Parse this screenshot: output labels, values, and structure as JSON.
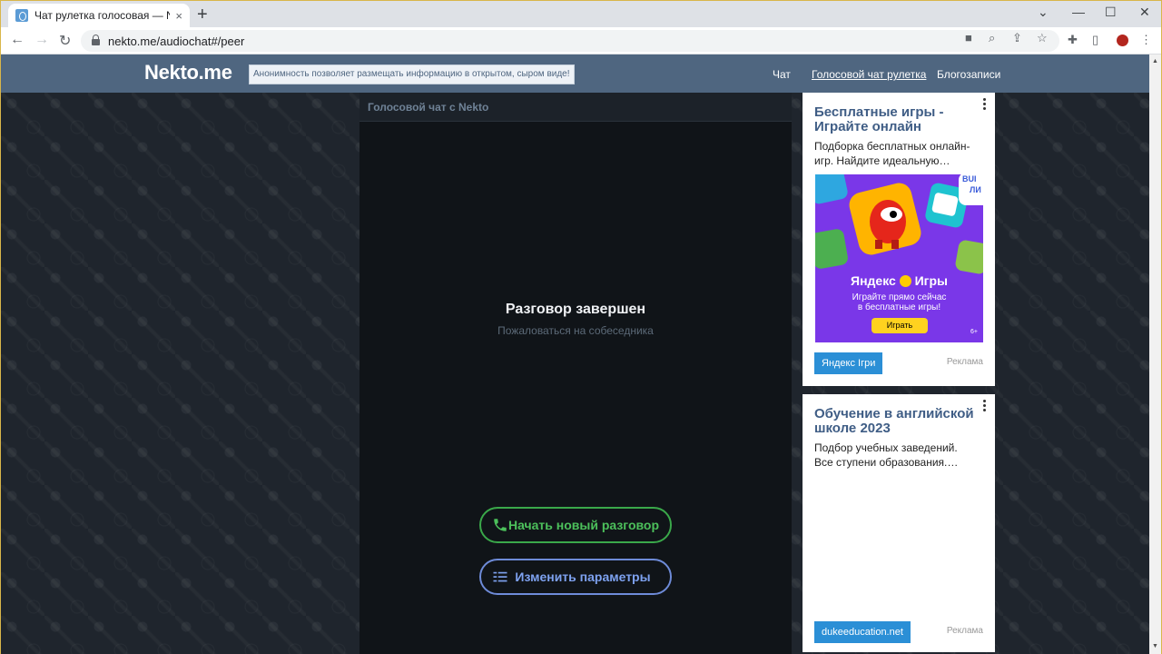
{
  "browser": {
    "tab_title": "Чат рулетка голосовая — Nekto.me",
    "tab_close": "×",
    "new_tab": "+",
    "url": "nekto.me/audiochat#/peer",
    "icons": [
      "camera-icon",
      "zoom-icon",
      "share-icon",
      "star-icon",
      "extensions-icon",
      "sidebar-icon",
      "profile-icon",
      "menu-icon"
    ],
    "window_controls": [
      "⌄",
      "—",
      "☐",
      "✕"
    ]
  },
  "site": {
    "logo": "Nekto.me",
    "tagline": "Анонимность позволяет размещать информацию в открытом, сыром виде!",
    "nav": [
      {
        "label": "Чат"
      },
      {
        "label": "Голосовой чат рулетка"
      },
      {
        "label": "Блогозаписи"
      }
    ],
    "accent_header": "#4f6680"
  },
  "chat": {
    "header_title": "Голосовой чат с Nekto",
    "status_title": "Разговор завершен",
    "report_link": "Пожаловаться на собеседника",
    "new_chat_button": "Начать новый разговор",
    "settings_button": "Изменить параметры",
    "colors": {
      "new_chat": "#4cc05b",
      "settings": "#7ea2f0"
    }
  },
  "ads": [
    {
      "title": "Бесплатные игры - Играйте онлайн",
      "text": "Подборка бесплатных онлайн-игр. Найдите идеальную…",
      "image": {
        "brand": "Яндекс",
        "product": "Игры",
        "tagline_1": "Играйте прямо сейчас",
        "tagline_2": "в бесплатные игры!",
        "play": "Играть",
        "age": "6+",
        "corner_text_1": "BUI",
        "corner_text_2": "ЛИ"
      },
      "cta": "Яндекс Ігри",
      "label": "Реклама"
    },
    {
      "title": "Обучение в английской школе 2023",
      "text": "Подбор учебных заведений. Все ступени образования.…",
      "cta": "dukeeducation.net",
      "label": "Реклама"
    }
  ]
}
